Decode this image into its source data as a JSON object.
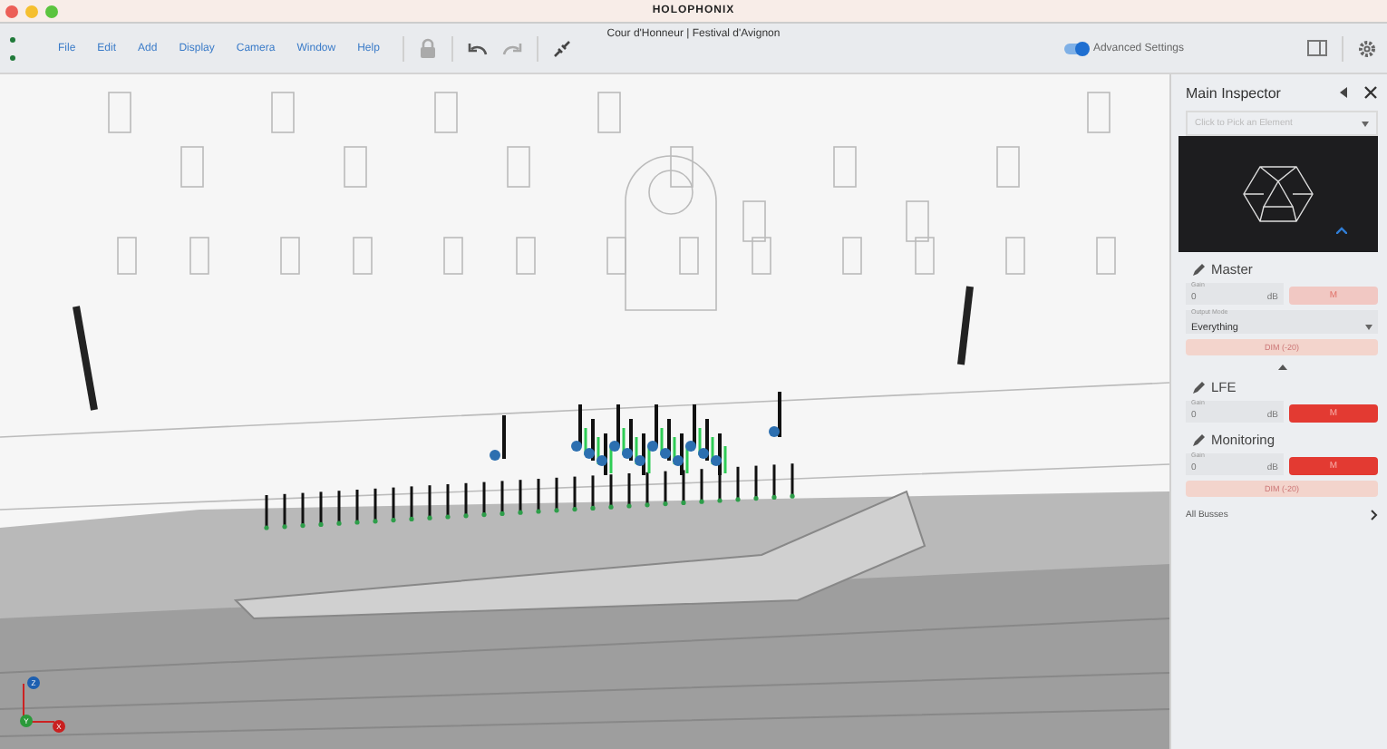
{
  "window": {
    "title": "HOLOPHONIX",
    "subtitle": "Cour d'Honneur | Festival d'Avignon"
  },
  "menu": [
    "File",
    "Edit",
    "Add",
    "Display",
    "Camera",
    "Window",
    "Help"
  ],
  "toolbar": {
    "advanced_settings": {
      "label": "Advanced Settings",
      "on": true
    }
  },
  "viewport": {
    "axes": [
      "Z",
      "Y",
      "X"
    ]
  },
  "inspector": {
    "title": "Main Inspector",
    "picker": {
      "placeholder": "Click to Pick an Element"
    },
    "sections": [
      {
        "name": "Master",
        "gain_label": "Gain",
        "gain": "0",
        "unit": "dB",
        "mute": {
          "label": "M",
          "on": false
        },
        "output_mode": {
          "label": "Output Mode",
          "value": "Everything"
        },
        "dim": {
          "label": "DIM (-20)",
          "on": false
        }
      },
      {
        "name": "LFE",
        "gain_label": "Gain",
        "gain": "0",
        "unit": "dB",
        "mute": {
          "label": "M",
          "on": true
        }
      },
      {
        "name": "Monitoring",
        "gain_label": "Gain",
        "gain": "0",
        "unit": "dB",
        "mute": {
          "label": "M",
          "on": true
        },
        "dim": {
          "label": "DIM (-20)",
          "on": false
        }
      }
    ],
    "all_busses": "All Busses"
  }
}
